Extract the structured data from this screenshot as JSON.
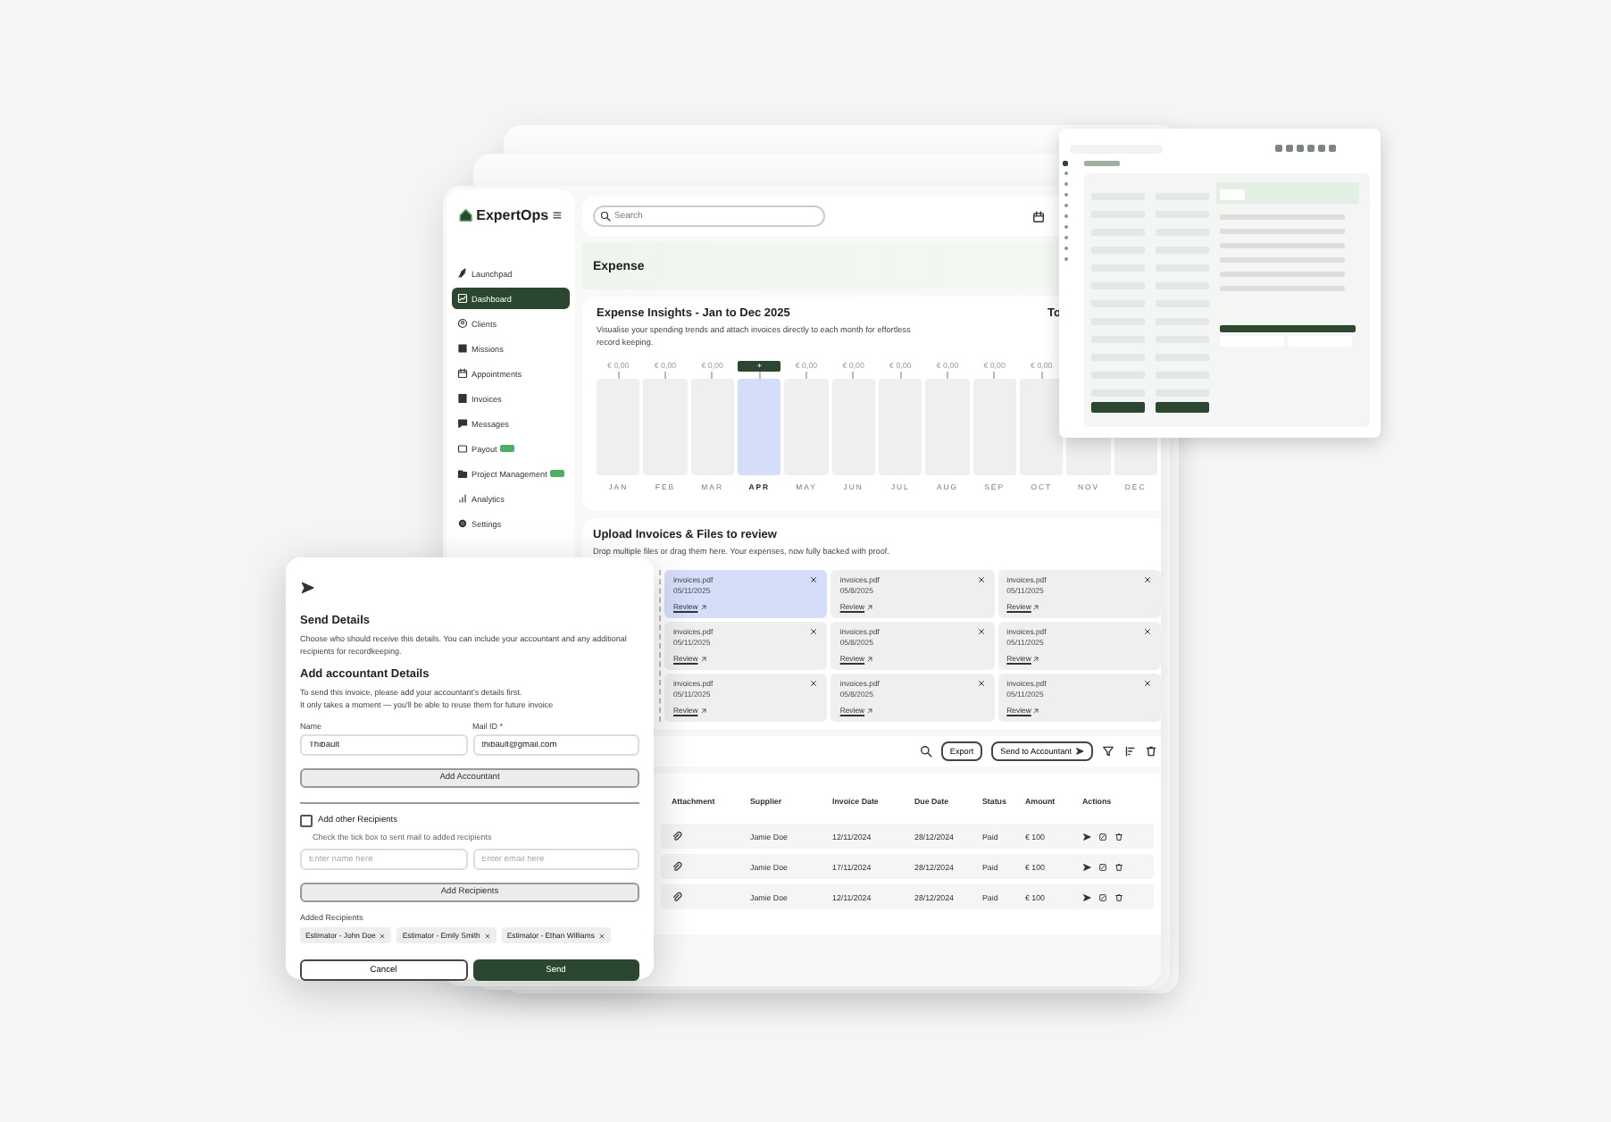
{
  "sidebar": {
    "logo": "ExpertOps",
    "items": [
      {
        "label": "Launchpad",
        "selected": false,
        "badge": false
      },
      {
        "label": "Dashboard",
        "selected": true,
        "badge": false
      },
      {
        "label": "Clients",
        "selected": false,
        "badge": false
      },
      {
        "label": "Missions",
        "selected": false,
        "badge": false
      },
      {
        "label": "Appointments",
        "selected": false,
        "badge": false
      },
      {
        "label": "Invoices",
        "selected": false,
        "badge": false
      },
      {
        "label": "Messages",
        "selected": false,
        "badge": false
      },
      {
        "label": "Payout",
        "selected": false,
        "badge": true
      },
      {
        "label": "Project Management",
        "selected": false,
        "badge": true
      },
      {
        "label": "Analytics",
        "selected": false,
        "badge": false
      },
      {
        "label": "Settings",
        "selected": false,
        "badge": false
      }
    ]
  },
  "topbar": {
    "search": {
      "placeholder": "Search"
    }
  },
  "page_title": "Expense",
  "insights": {
    "title": "Expense Insights - Jan to Dec 2025",
    "description": "Visualise your spending trends and attach invoices directly to each month for effortless record keeping.",
    "side_title": "To",
    "months": [
      {
        "label": "JAN",
        "amount": "€ 0,00",
        "selected": false
      },
      {
        "label": "FEB",
        "amount": "€ 0,00",
        "selected": false
      },
      {
        "label": "MAR",
        "amount": "€ 0,00",
        "selected": false
      },
      {
        "label": "APR",
        "amount": "+",
        "selected": true
      },
      {
        "label": "MAY",
        "amount": "€ 0,00",
        "selected": false
      },
      {
        "label": "JUN",
        "amount": "€ 0,00",
        "selected": false
      },
      {
        "label": "JUL",
        "amount": "€ 0,00",
        "selected": false
      },
      {
        "label": "AUG",
        "amount": "€ 0,00",
        "selected": false
      },
      {
        "label": "SEP",
        "amount": "€ 0,00",
        "selected": false
      },
      {
        "label": "OCT",
        "amount": "€ 0,00",
        "selected": false
      },
      {
        "label": "NOV",
        "selected": false
      },
      {
        "label": "DEC",
        "selected": false
      }
    ]
  },
  "upload": {
    "title": "Upload Invoices & Files to review",
    "description": "Drop multiple files or drag them here. Your expenses, now fully backed with proof.",
    "files": [
      {
        "name": "invoices.pdf",
        "date": "05/11/2025",
        "link": "Review",
        "selected": true
      },
      {
        "name": "invoices.pdf",
        "date": "05/8/2025",
        "link": "Review",
        "selected": false
      },
      {
        "name": "invoices.pdf",
        "date": "05/11/2025",
        "link": "Review",
        "selected": false
      },
      {
        "name": "invoices.pdf",
        "date": "05/11/2025",
        "link": "Review",
        "selected": false
      },
      {
        "name": "invoices.pdf",
        "date": "05/8/2025",
        "link": "Review",
        "selected": false
      },
      {
        "name": "invoices.pdf",
        "date": "05/11/2025",
        "link": "Review",
        "selected": false
      },
      {
        "name": "invoices.pdf",
        "date": "05/11/2025",
        "link": "Review",
        "selected": false
      },
      {
        "name": "invoices.pdf",
        "date": "05/8/2025",
        "link": "Review",
        "selected": false
      },
      {
        "name": "invoices.pdf",
        "date": "05/11/2025",
        "link": "Review",
        "selected": false
      }
    ]
  },
  "toolbar": {
    "export": "Export",
    "send": "Send to Accountant"
  },
  "table": {
    "columns": [
      "Attachment",
      "Supplier",
      "Invoice Date",
      "Due Date",
      "Status",
      "Amount",
      "Actions"
    ],
    "rows": [
      {
        "supplier": "Jamie Doe",
        "invoice_date": "12/11/2024",
        "due_date": "28/12/2024",
        "status": "Paid",
        "amount": "€ 100"
      },
      {
        "supplier": "Jamie Doe",
        "invoice_date": "17/11/2024",
        "due_date": "28/12/2024",
        "status": "Paid",
        "amount": "€ 100"
      },
      {
        "supplier": "Jamie Doe",
        "invoice_date": "12/11/2024",
        "due_date": "28/12/2024",
        "status": "Paid",
        "amount": "€ 100"
      }
    ]
  },
  "dialog": {
    "title": "Send Details",
    "description": "Choose who should receive this details. You can include your accountant and any additional recipients for recordkeeping.",
    "section_title": "Add accountant Details",
    "section_description": "To send this invoice, please add your accountant's details first.\n It only takes a moment — you'll be able to reuse them for future invoice",
    "name_label": "Name",
    "mail_label": "Mail ID *",
    "name_value": "Thibault",
    "mail_value": "thibault@gmail.com",
    "add_accountant": "Add Accountant",
    "other": {
      "label": "Add other Recipients",
      "checked": false,
      "hint": "Check the tick box to sent mail to added recipients"
    },
    "name_placeholder": "Enter name here",
    "email_placeholder": "Enter email here",
    "add_recipients": "Add Recipients",
    "added_label": "Added Recipients",
    "chips": [
      "Estimator - John Doe",
      "Estimator - Emily Smith",
      "Estimator - Ethan Williams"
    ],
    "cancel": "Cancel",
    "send": "Send"
  }
}
